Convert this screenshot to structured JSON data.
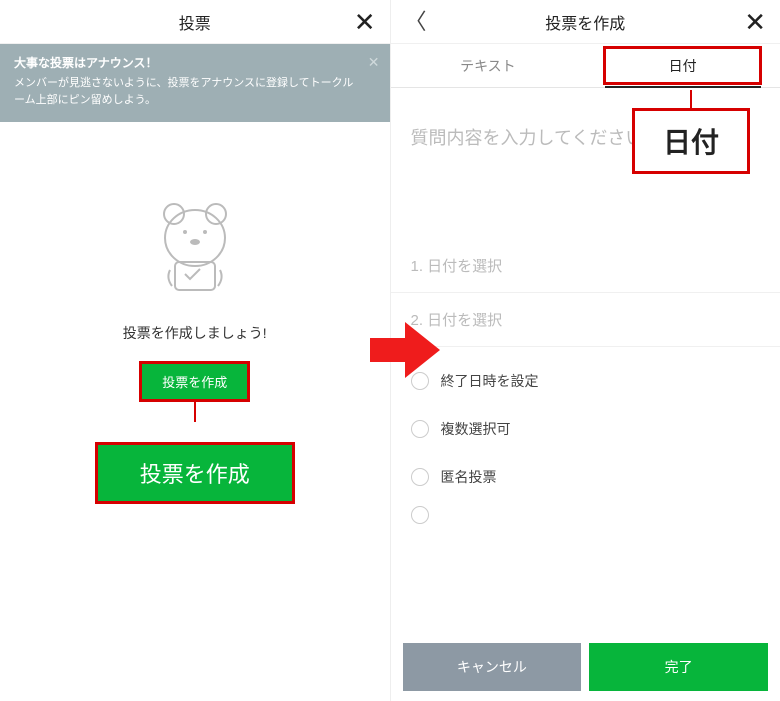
{
  "left": {
    "title": "投票",
    "banner": {
      "title": "大事な投票はアナウンス！",
      "body": "メンバーが見逃さないように、投票をアナウンスに登録してトークルーム上部にピン留めしよう。"
    },
    "prompt": "投票を作成しましょう!",
    "create_button": "投票を作成",
    "create_button_big": "投票を作成"
  },
  "right": {
    "title": "投票を作成",
    "tabs": {
      "text": "テキスト",
      "date": "日付"
    },
    "date_callout": "日付",
    "question_placeholder": "質問内容を入力してください",
    "options": [
      "1. 日付を選択",
      "2. 日付を選択"
    ],
    "checks": [
      "終了日時を設定",
      "複数選択可",
      "匿名投票"
    ],
    "buttons": {
      "cancel": "キャンセル",
      "done": "完了"
    }
  }
}
